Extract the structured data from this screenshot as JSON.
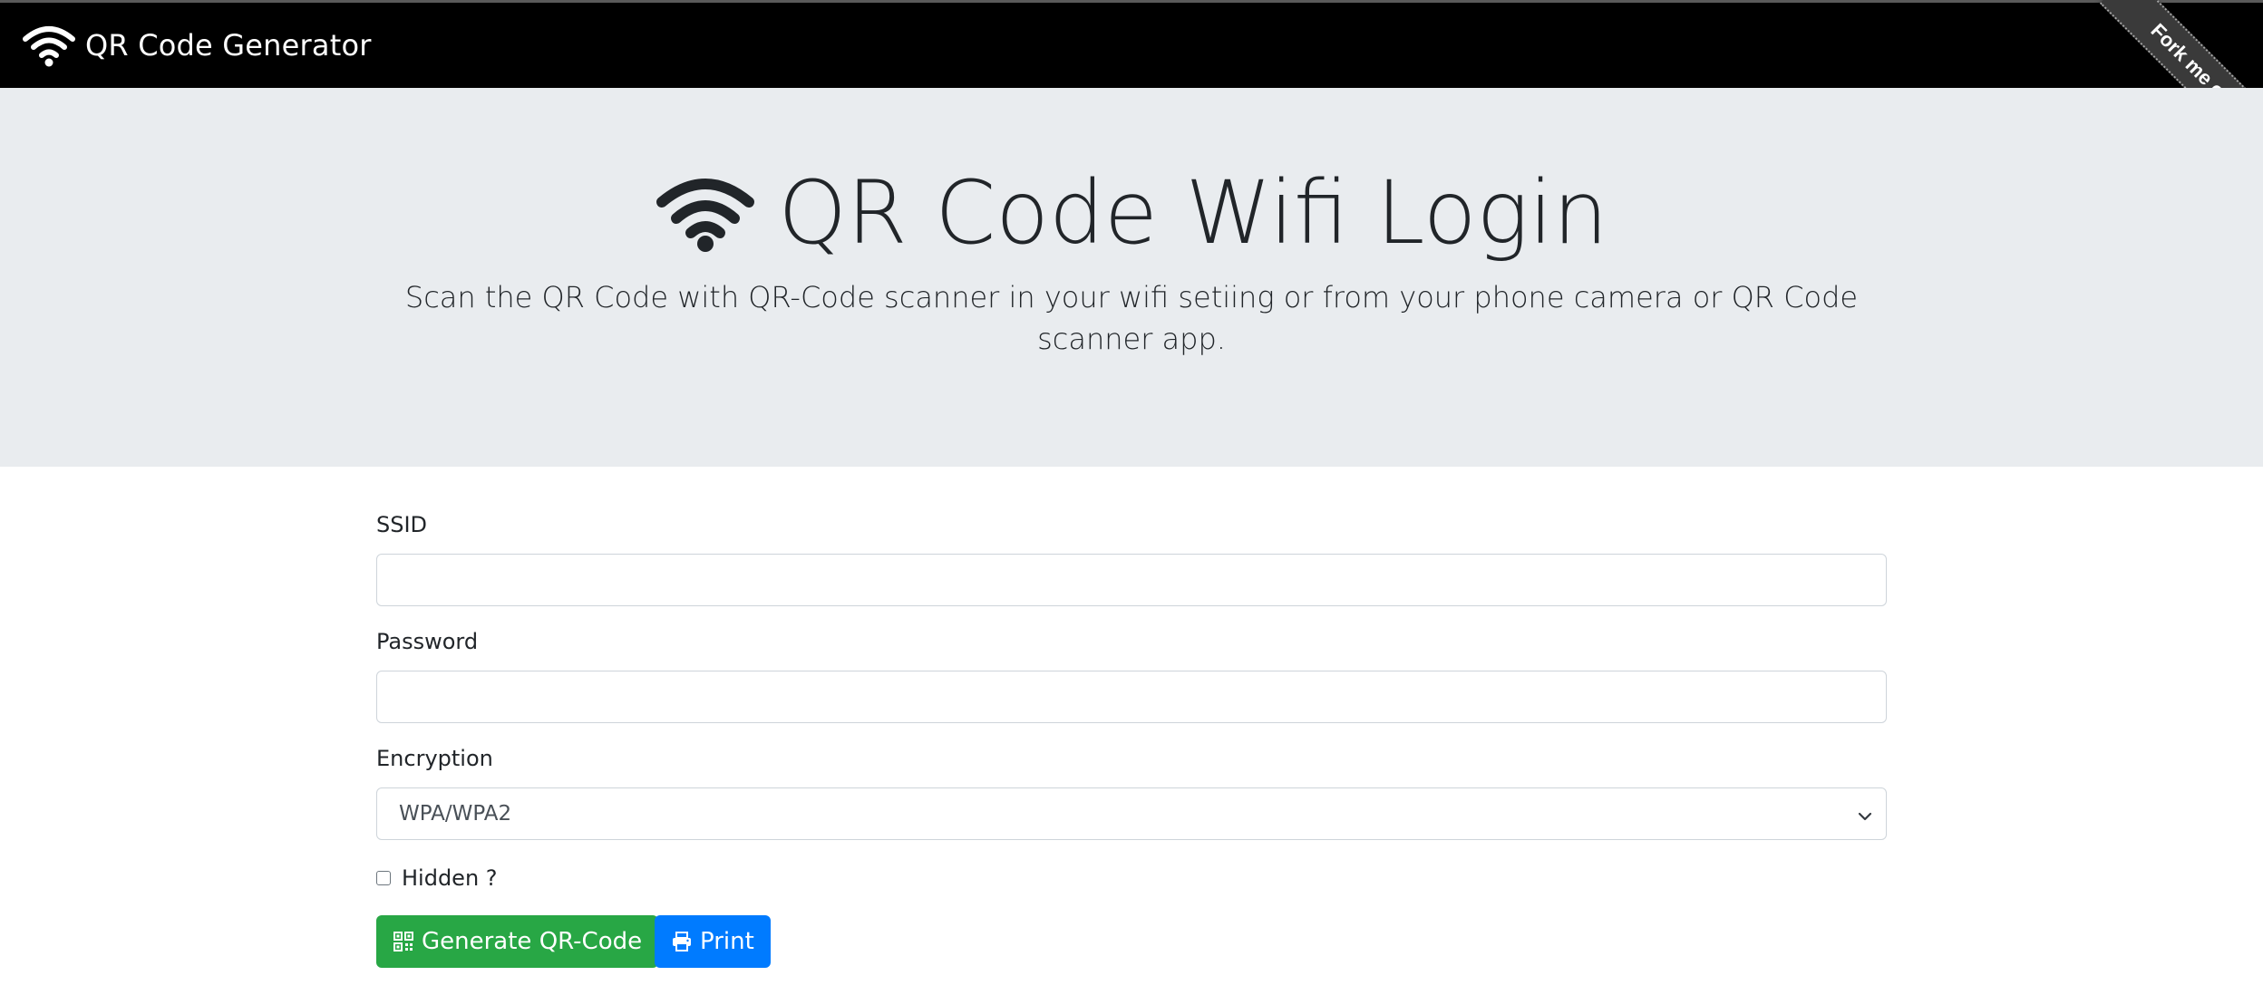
{
  "navbar": {
    "brand_icon": "wifi-icon",
    "brand_text": "QR Code Generator"
  },
  "ribbon": {
    "label": "Fork me on GitHub"
  },
  "hero": {
    "icon": "wifi-icon",
    "title": "QR Code Wifi Login",
    "lead": "Scan the QR Code with QR-Code scanner in your wifi setiing or from your phone camera or QR Code scanner app."
  },
  "form": {
    "ssid_label": "SSID",
    "ssid_value": "",
    "password_label": "Password",
    "password_value": "",
    "encryption_label": "Encryption",
    "encryption_selected": "WPA/WPA2",
    "hidden_label": "Hidden ?",
    "hidden_checked": false
  },
  "buttons": {
    "generate_label": "Generate QR-Code",
    "generate_icon": "qrcode-icon",
    "print_label": "Print",
    "print_icon": "printer-icon"
  },
  "colors": {
    "navbar_bg": "#000000",
    "jumbotron_bg": "#e9ecef",
    "success": "#28a745",
    "primary": "#007bff",
    "ribbon_bg": "#3a3a3a"
  }
}
